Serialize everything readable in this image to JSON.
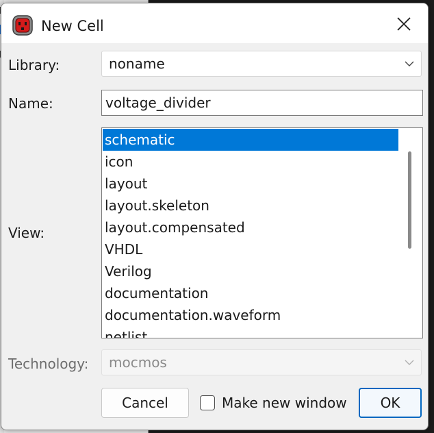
{
  "dialog": {
    "title": "New Cell",
    "icon": "electric-app-icon"
  },
  "form": {
    "library_label": "Library:",
    "library_value": "noname",
    "name_label": "Name:",
    "name_value": "voltage_divider",
    "view_label": "View:",
    "views": [
      "schematic",
      "icon",
      "layout",
      "layout.skeleton",
      "layout.compensated",
      "VHDL",
      "Verilog",
      "documentation",
      "documentation.waveform",
      "netlist"
    ],
    "selected_view": "schematic",
    "technology_label": "Technology:",
    "technology_value": "mocmos"
  },
  "buttons": {
    "cancel": "Cancel",
    "new_window_label": "Make new window",
    "new_window_checked": false,
    "ok": "OK"
  },
  "colors": {
    "selection": "#0078d7",
    "default_button_border": "#0067c0"
  }
}
